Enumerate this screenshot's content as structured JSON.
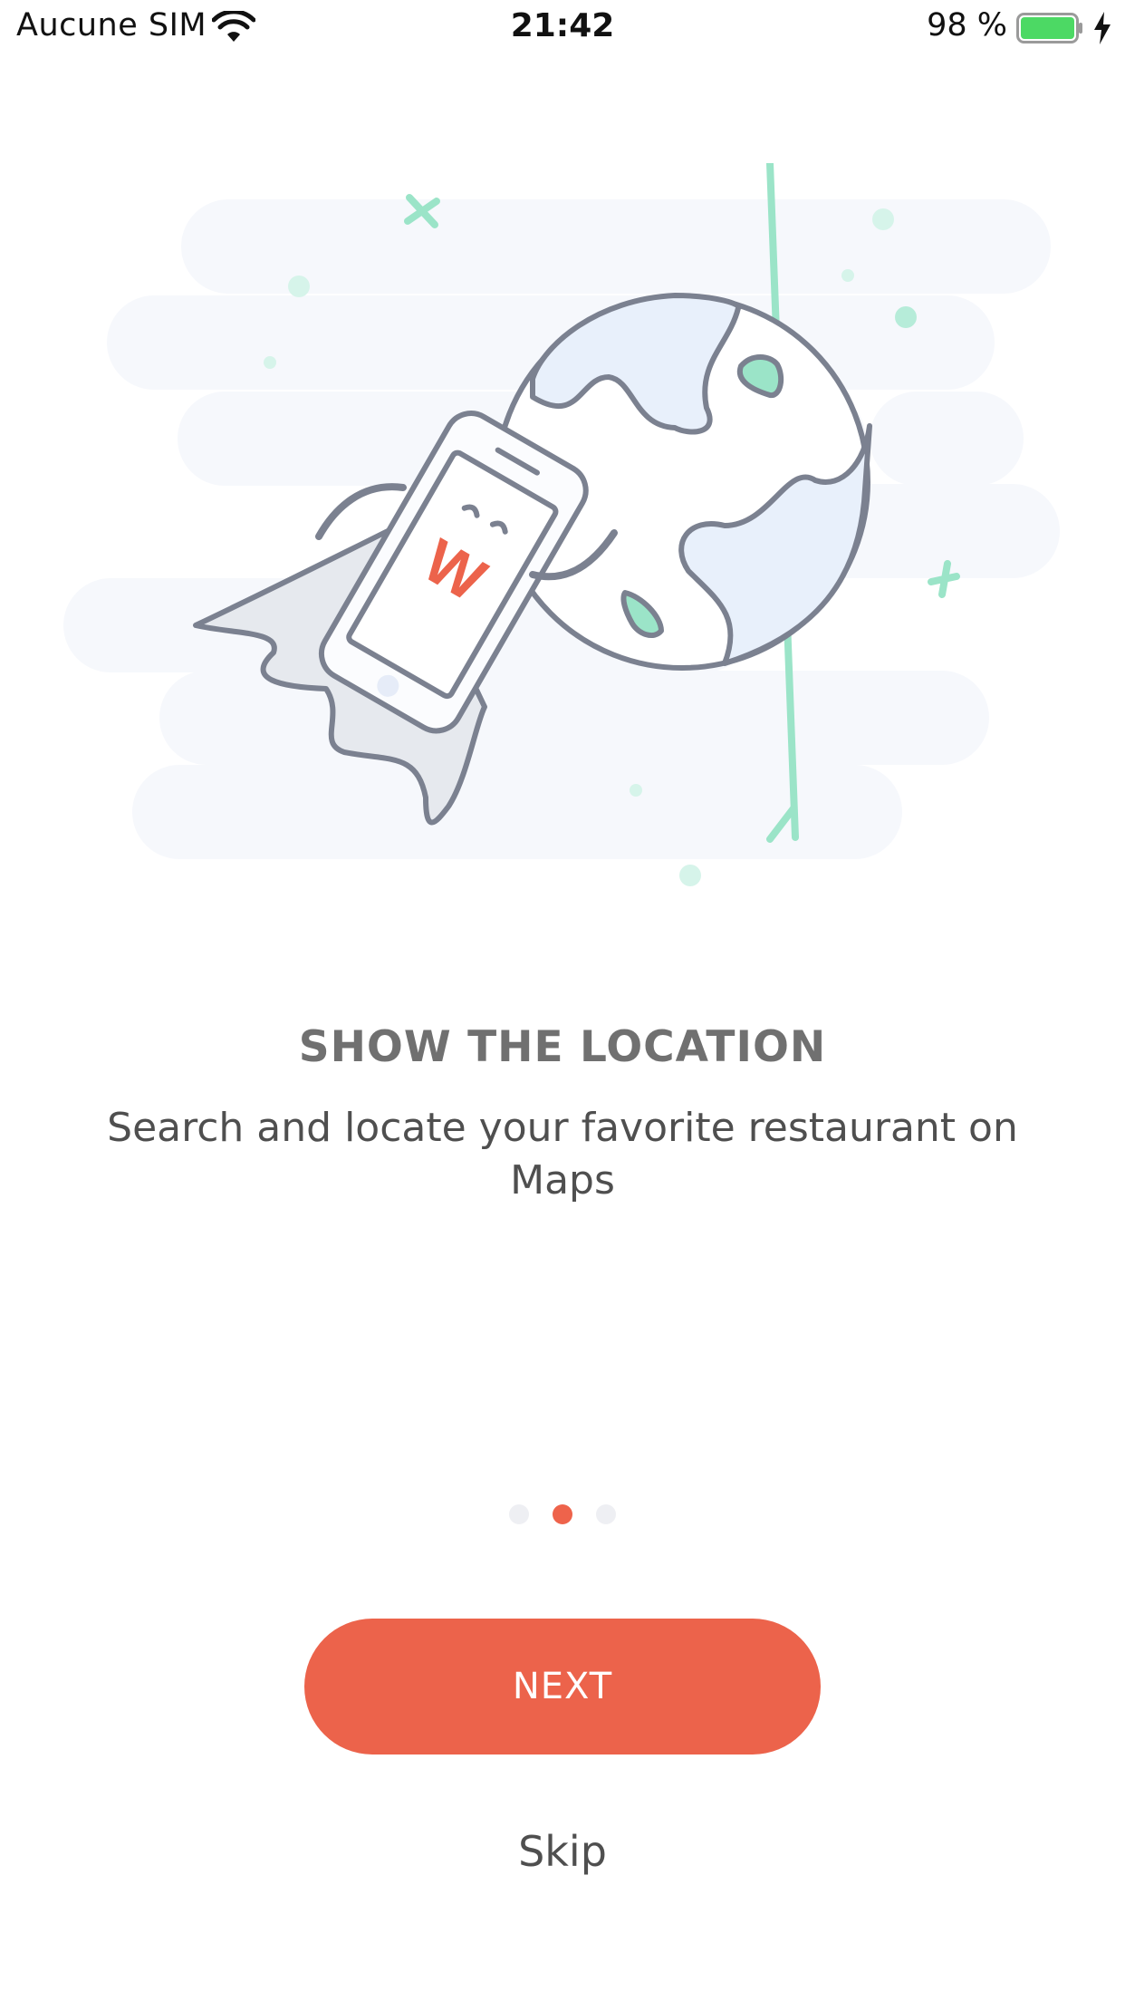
{
  "status_bar": {
    "carrier": "Aucune SIM",
    "time": "21:42",
    "battery_percent": "98 %",
    "icons": [
      "wifi-icon",
      "battery-icon",
      "charging-bolt-icon"
    ],
    "battery_color": "#4cd964"
  },
  "illustration": {
    "subject": "phone-with-cape-flying-to-globe",
    "phone_logo": "W"
  },
  "onboarding": {
    "title": "SHOW THE LOCATION",
    "description": "Search and locate your favorite restaurant on Maps",
    "page_indicator": {
      "total": 3,
      "active_index": 1
    }
  },
  "actions": {
    "next_label": "NEXT",
    "skip_label": "Skip"
  },
  "colors": {
    "accent": "#ec634b",
    "title": "#707070",
    "text": "#4f4f4f",
    "dot_inactive": "#eeeff3",
    "illustration_mint": "#9be4c8",
    "illustration_outline": "#7b8190",
    "illustration_bg": "#f6f8fc"
  }
}
